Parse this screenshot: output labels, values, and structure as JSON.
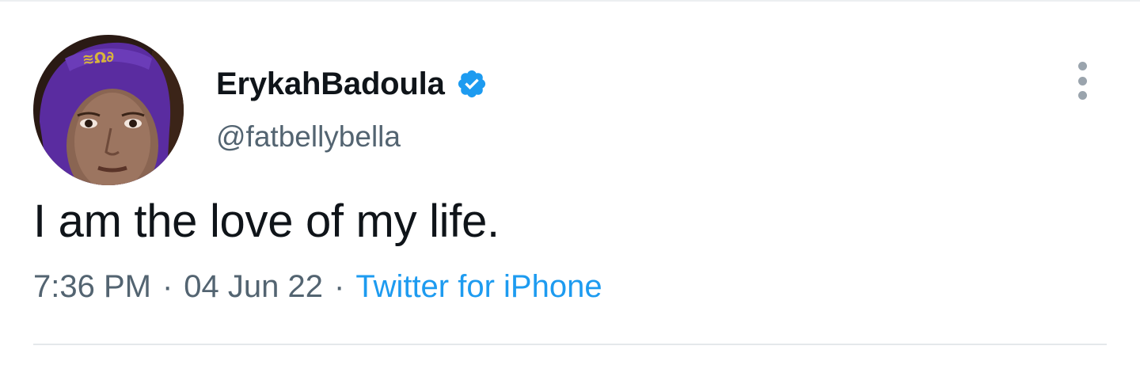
{
  "tweet": {
    "author": {
      "display_name": "ErykahBadoula",
      "handle": "@fatbellybella",
      "verified": true,
      "avatar_icon": "profile-photo"
    },
    "text": "I am the love of my life.",
    "time": "7:36 PM",
    "date": "04 Jun 22",
    "separator": "·",
    "source": "Twitter for iPhone",
    "menu_icon": "more-vertical-icon"
  },
  "colors": {
    "text_primary": "#0f1419",
    "text_secondary": "#536471",
    "link": "#1d9bf0",
    "verified_badge": "#1d9bf0",
    "hat": "#5a2ca0"
  }
}
